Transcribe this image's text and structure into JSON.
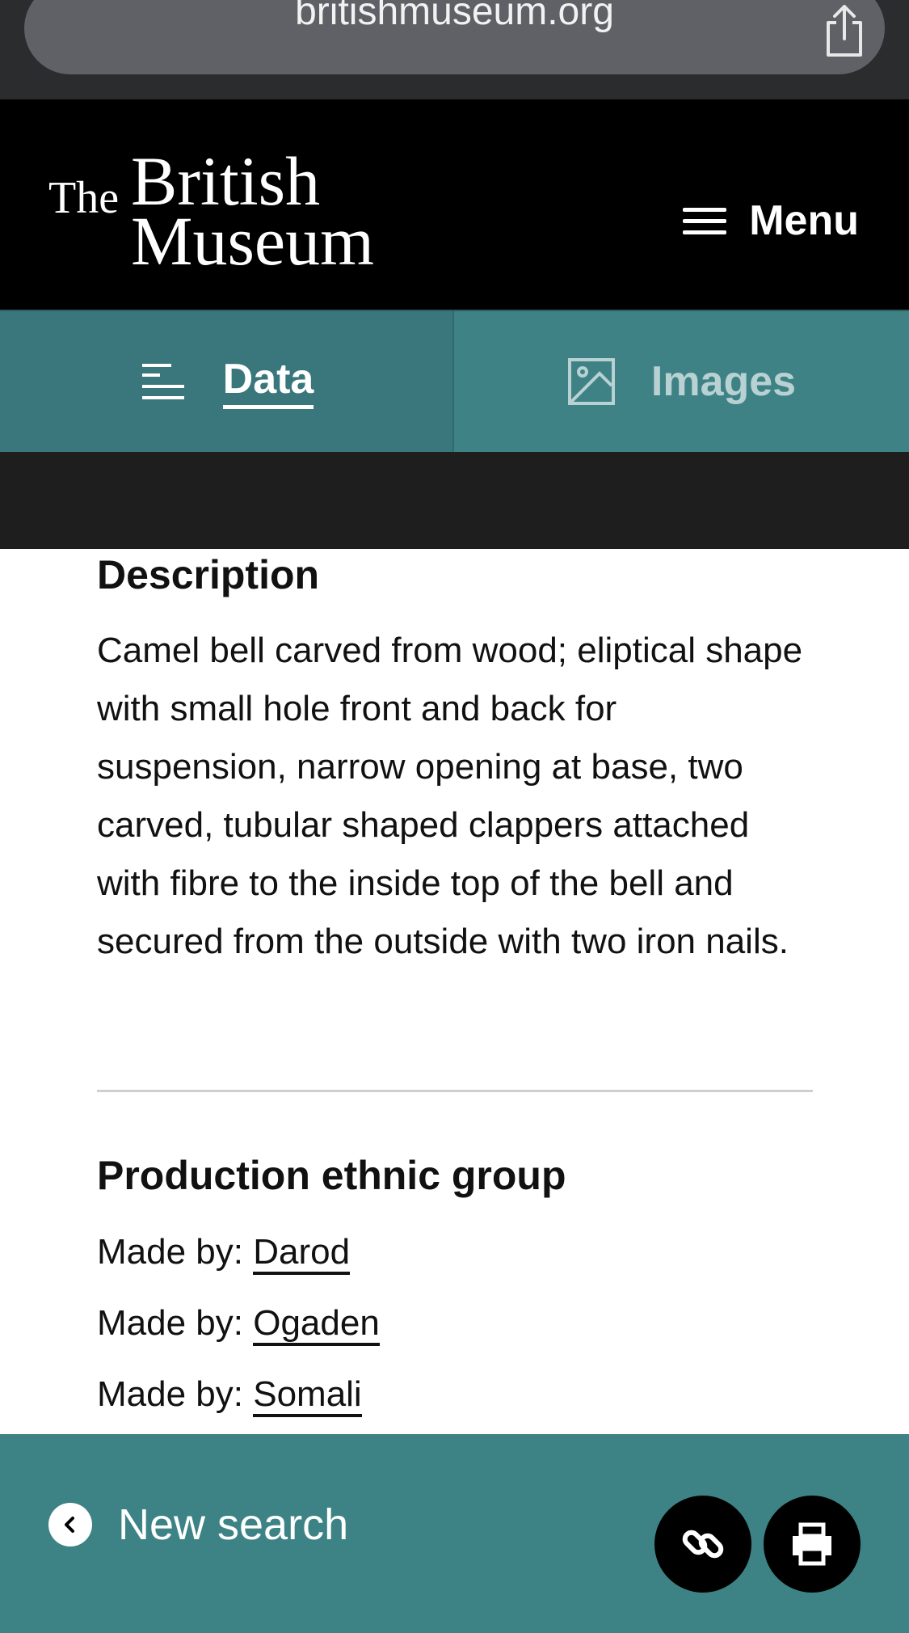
{
  "browser": {
    "url": "britishmuseum.org"
  },
  "header": {
    "logo": {
      "the": "The",
      "british": "British",
      "museum": "Museum"
    },
    "menu_label": "Menu"
  },
  "tabs": [
    {
      "label": "Data",
      "active": true
    },
    {
      "label": "Images",
      "active": false
    }
  ],
  "description": {
    "heading": "Description",
    "text": "Camel bell carved from wood; eliptical shape with small hole front and back for suspension, narrow opening at base, two carved, tubular shaped clappers attached with fibre to the inside top of the bell and secured from the outside with two iron nails."
  },
  "production": {
    "heading": "Production ethnic group",
    "items": [
      {
        "prefix": "Made by:",
        "link": "Darod"
      },
      {
        "prefix": "Made by:",
        "link": "Ogaden"
      },
      {
        "prefix": "Made by:",
        "link": "Somali"
      }
    ]
  },
  "footer": {
    "new_search_label": "New search"
  },
  "colors": {
    "teal": "#3d8385",
    "teal_dark": "#3a777c",
    "header_bg": "#000000"
  }
}
